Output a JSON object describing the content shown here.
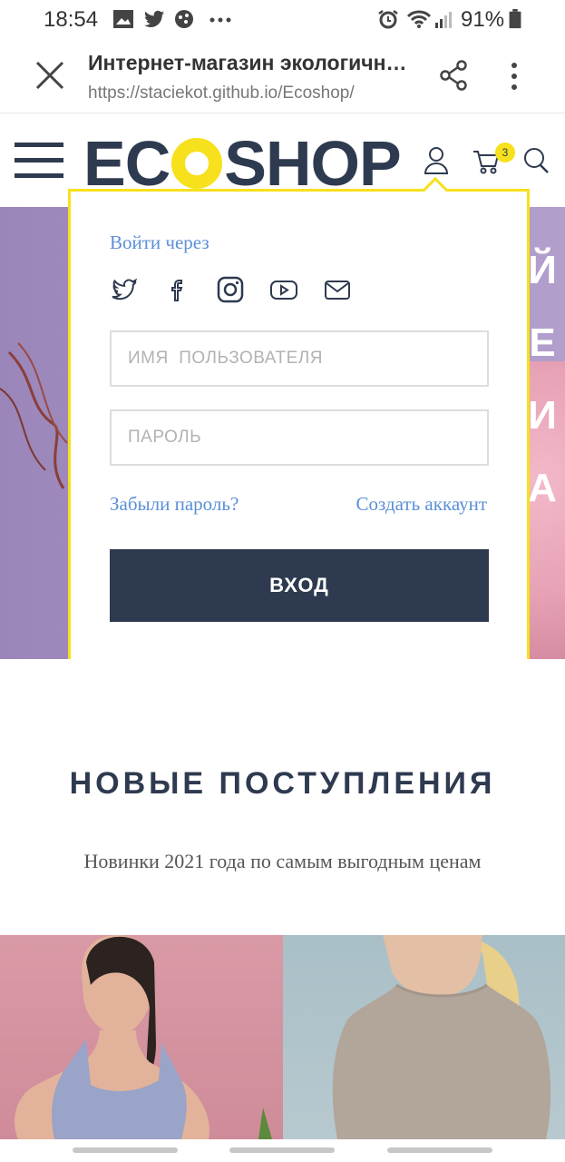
{
  "status_bar": {
    "time": "18:54",
    "battery": "91%",
    "icons": [
      "gallery-icon",
      "twitter-icon",
      "game-icon",
      "more-dots-icon",
      "alarm-icon",
      "wifi-icon",
      "signal-icon",
      "battery-icon"
    ]
  },
  "browser": {
    "title": "Интернет-магазин экологичн…",
    "url": "https://staciekot.github.io/Ecoshop/"
  },
  "header": {
    "logo_left": "EC",
    "logo_right": "SHOP",
    "cart_count": "3"
  },
  "hero": {
    "side_letters": [
      "Й",
      "Е",
      "И",
      "А"
    ]
  },
  "login": {
    "via_label": "Войти через",
    "social": [
      "twitter",
      "facebook",
      "instagram",
      "youtube",
      "email"
    ],
    "username_placeholder": "ИМЯ  ПОЛЬЗОВАТЕЛЯ",
    "password_placeholder": "ПАРОЛЬ",
    "forgot": "Забыли пароль?",
    "create": "Создать аккаунт",
    "submit": "ВХОД"
  },
  "new_arrivals": {
    "heading": "НОВЫЕ ПОСТУПЛЕНИЯ",
    "subtitle": "Новинки 2021 года по самым выгодным ценам"
  },
  "colors": {
    "accent": "#f7e01c",
    "navy": "#2e3a4f",
    "link": "#5b8fd6"
  }
}
